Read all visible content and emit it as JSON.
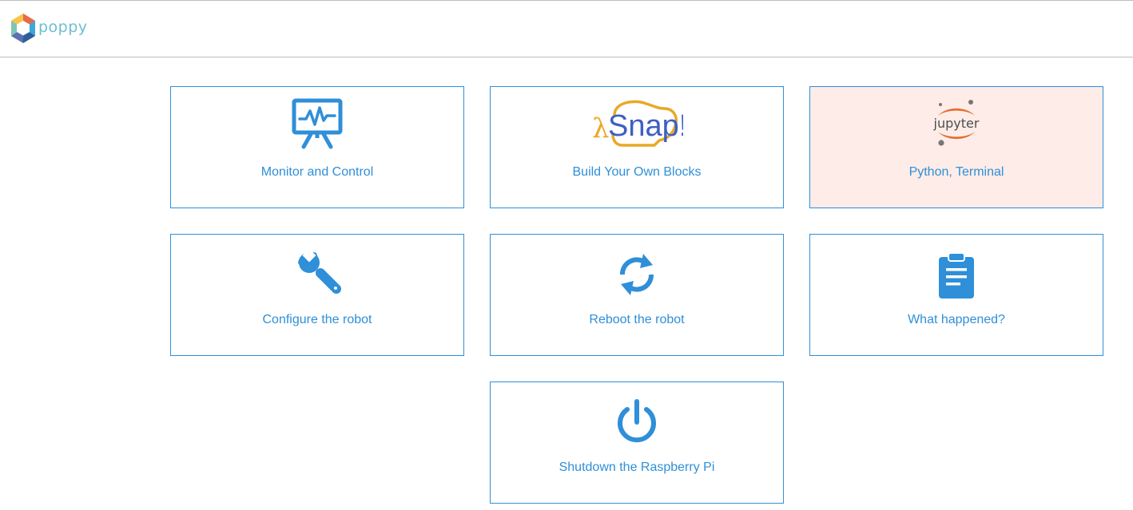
{
  "header": {
    "brand_name": "poppy",
    "logo_icon": "poppy-hexagon-logo"
  },
  "colors": {
    "accent": "#2f8fd8",
    "brand_text": "#6cbfd0",
    "highlight_bg": "#fdece8",
    "border": "#bdbdbd"
  },
  "tiles": [
    {
      "label": "Monitor and Control",
      "icon": "monitor-chart-icon"
    },
    {
      "label": "Build Your Own Blocks",
      "icon": "snap-logo",
      "logo_text": "Snap!"
    },
    {
      "label": "Python, Terminal",
      "icon": "jupyter-logo",
      "logo_text": "jupyter",
      "highlighted": true
    },
    {
      "label": "Configure the robot",
      "icon": "wrench-icon"
    },
    {
      "label": "Reboot the robot",
      "icon": "refresh-icon"
    },
    {
      "label": "What happened?",
      "icon": "clipboard-icon"
    },
    {
      "label": "Shutdown the Raspberry Pi",
      "icon": "power-icon"
    }
  ]
}
